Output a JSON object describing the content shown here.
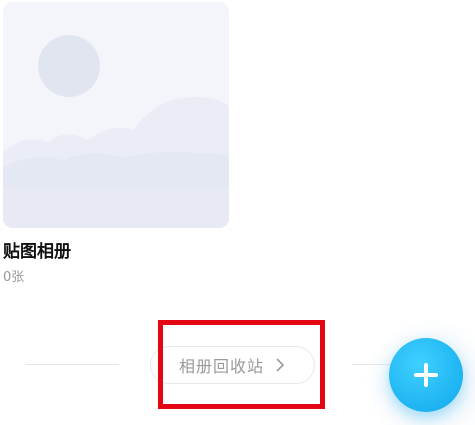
{
  "album": {
    "title": "贴图相册",
    "count": "0张",
    "cover_icon": "image-placeholder-icon"
  },
  "footer": {
    "recycle_bin_label": "相册回收站",
    "chevron_icon": "chevron-right-icon"
  },
  "fab": {
    "icon": "plus-icon",
    "color": "#1eb8f5"
  },
  "highlight": {
    "color": "#e30613"
  }
}
